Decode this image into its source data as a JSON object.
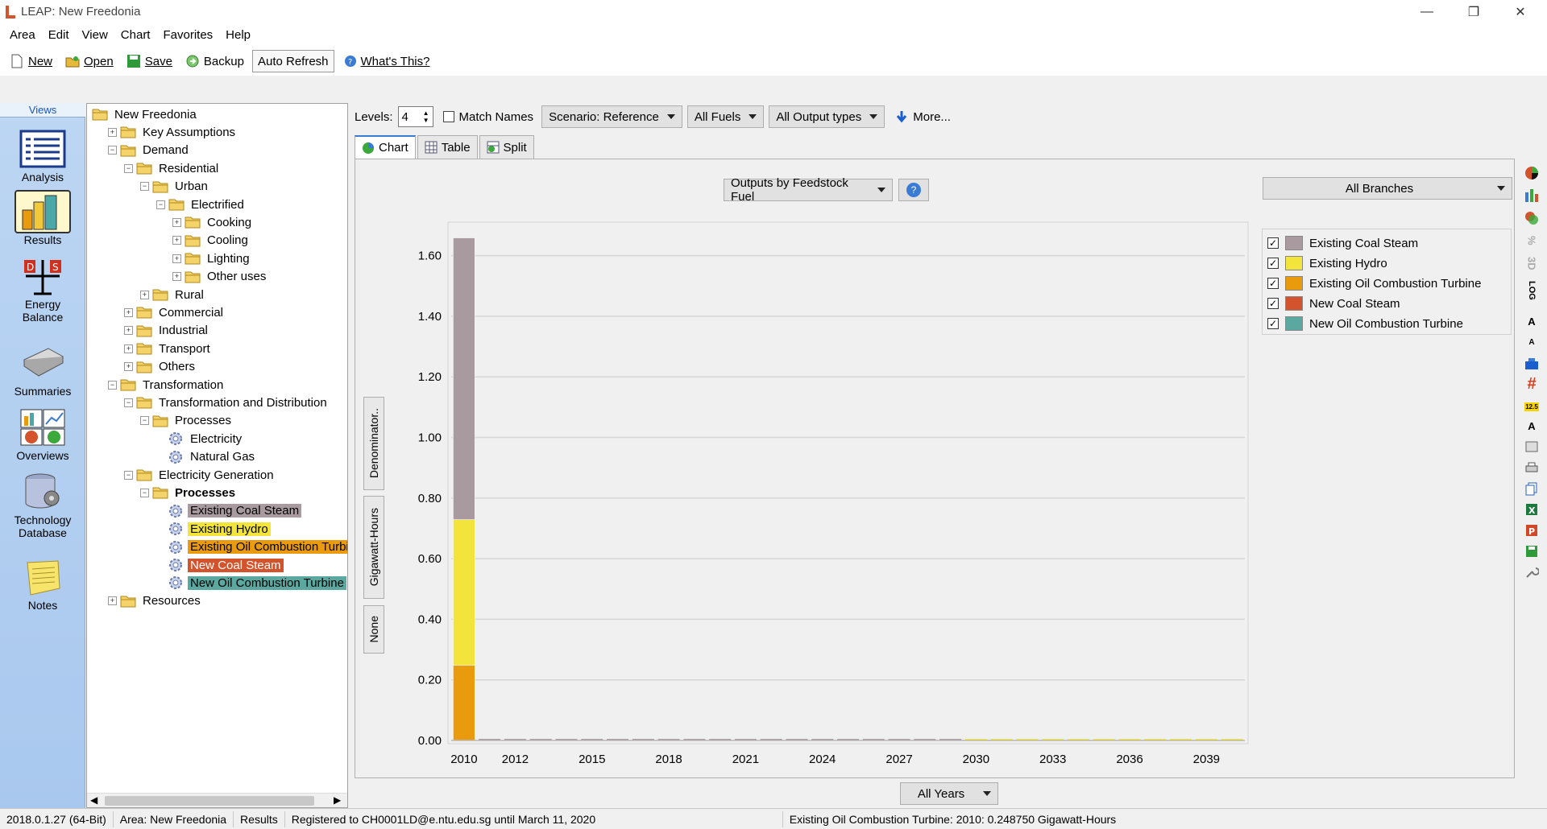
{
  "window": {
    "title": "LEAP: New Freedonia",
    "min": "—",
    "restore": "❐",
    "close": "✕"
  },
  "menu": [
    "Area",
    "Edit",
    "View",
    "Chart",
    "Favorites",
    "Help"
  ],
  "toolbar": {
    "new": "New",
    "open": "Open",
    "save": "Save",
    "backup": "Backup",
    "auto_refresh": "Auto Refresh",
    "whats_this": "What's This?"
  },
  "views": {
    "header": "Views",
    "items": [
      {
        "label": "Analysis",
        "icon": "analysis-icon"
      },
      {
        "label": "Results",
        "icon": "results-icon"
      },
      {
        "label": "Energy\nBalance",
        "icon": "energy-balance-icon"
      },
      {
        "label": "Summaries",
        "icon": "summaries-icon"
      },
      {
        "label": "Overviews",
        "icon": "overviews-icon"
      },
      {
        "label": "Technology\nDatabase",
        "icon": "technology-database-icon"
      },
      {
        "label": "Notes",
        "icon": "notes-icon"
      }
    ]
  },
  "tree": [
    {
      "label": "New Freedonia",
      "level": 0,
      "pm": "",
      "kind": "folder"
    },
    {
      "label": "Key Assumptions",
      "level": 1,
      "pm": "+",
      "kind": "folder"
    },
    {
      "label": "Demand",
      "level": 1,
      "pm": "-",
      "kind": "folder"
    },
    {
      "label": "Residential",
      "level": 2,
      "pm": "-",
      "kind": "folder"
    },
    {
      "label": "Urban",
      "level": 3,
      "pm": "-",
      "kind": "folder"
    },
    {
      "label": "Electrified",
      "level": 4,
      "pm": "-",
      "kind": "folder"
    },
    {
      "label": "Cooking",
      "level": 5,
      "pm": "+",
      "kind": "folder"
    },
    {
      "label": "Cooling",
      "level": 5,
      "pm": "+",
      "kind": "folder"
    },
    {
      "label": "Lighting",
      "level": 5,
      "pm": "+",
      "kind": "folder"
    },
    {
      "label": "Other uses",
      "level": 5,
      "pm": "+",
      "kind": "folder"
    },
    {
      "label": "Rural",
      "level": 3,
      "pm": "+",
      "kind": "folder"
    },
    {
      "label": "Commercial",
      "level": 2,
      "pm": "+",
      "kind": "folder"
    },
    {
      "label": "Industrial",
      "level": 2,
      "pm": "+",
      "kind": "folder"
    },
    {
      "label": "Transport",
      "level": 2,
      "pm": "+",
      "kind": "folder"
    },
    {
      "label": "Others",
      "level": 2,
      "pm": "+",
      "kind": "folder"
    },
    {
      "label": "Transformation",
      "level": 1,
      "pm": "-",
      "kind": "folder"
    },
    {
      "label": "Transformation and Distribution",
      "level": 2,
      "pm": "-",
      "kind": "folder"
    },
    {
      "label": "Processes",
      "level": 3,
      "pm": "-",
      "kind": "folder"
    },
    {
      "label": "Electricity",
      "level": 4,
      "pm": "",
      "kind": "gear"
    },
    {
      "label": "Natural Gas",
      "level": 4,
      "pm": "",
      "kind": "gear"
    },
    {
      "label": "Electricity Generation",
      "level": 2,
      "pm": "-",
      "kind": "folder"
    },
    {
      "label": "Processes",
      "level": 3,
      "pm": "-",
      "kind": "folder",
      "bold": true
    },
    {
      "label": "Existing Coal Steam",
      "level": 4,
      "pm": "",
      "kind": "gear",
      "hl": "#a99aa0",
      "fg": "#000"
    },
    {
      "label": "Existing Hydro",
      "level": 4,
      "pm": "",
      "kind": "gear",
      "hl": "#f2e43a",
      "fg": "#000"
    },
    {
      "label": "Existing Oil Combustion Turbi",
      "level": 4,
      "pm": "",
      "kind": "gear",
      "hl": "#ea9a0d",
      "fg": "#000"
    },
    {
      "label": "New Coal Steam",
      "level": 4,
      "pm": "",
      "kind": "gear",
      "hl": "#d2532c",
      "fg": "#fff"
    },
    {
      "label": "New Oil Combustion Turbine",
      "level": 4,
      "pm": "",
      "kind": "gear",
      "hl": "#5ba8a0",
      "fg": "#000"
    },
    {
      "label": "Resources",
      "level": 1,
      "pm": "+",
      "kind": "folder"
    }
  ],
  "controls": {
    "levels_label": "Levels:",
    "levels_value": "4",
    "match_names": "Match Names",
    "scenario": "Scenario: Reference",
    "fuels": "All Fuels",
    "output_types": "All Output types",
    "more": "More..."
  },
  "tabs": [
    "Chart",
    "Table",
    "Split"
  ],
  "chart_controls": {
    "outputs": "Outputs by Feedstock Fuel",
    "help": "?",
    "branches": "All Branches",
    "years": "All Years"
  },
  "side_buttons": [
    "Denominator..",
    "Gigawatt-Hours",
    "None"
  ],
  "right_tools": [
    "LOG",
    "3D",
    "A",
    "12.5"
  ],
  "chart_data": {
    "type": "bar",
    "stacked": true,
    "x": [
      2010,
      2011,
      2012,
      2013,
      2014,
      2015,
      2016,
      2017,
      2018,
      2019,
      2020,
      2021,
      2022,
      2023,
      2024,
      2025,
      2026,
      2027,
      2028,
      2029,
      2030,
      2031,
      2032,
      2033,
      2034,
      2035,
      2036,
      2037,
      2038,
      2039,
      2040
    ],
    "x_tick_labels": [
      "2010",
      "2012",
      "2015",
      "2018",
      "2021",
      "2024",
      "2027",
      "2030",
      "2033",
      "2036",
      "2039"
    ],
    "y_tick_labels": [
      "0.00",
      "0.20",
      "0.40",
      "0.60",
      "0.80",
      "1.00",
      "1.20",
      "1.40",
      "1.60"
    ],
    "ylim": [
      0,
      1.7
    ],
    "ylabel": "Gigawatt-Hours",
    "grid": true,
    "legend_position": "right",
    "series": [
      {
        "name": "Existing Oil Combustion Turbine",
        "color": "#ea9a0d",
        "values": [
          0.24875,
          0,
          0,
          0,
          0,
          0,
          0,
          0,
          0,
          0,
          0,
          0,
          0,
          0,
          0,
          0,
          0,
          0,
          0,
          0,
          0,
          0,
          0,
          0,
          0,
          0,
          0,
          0,
          0,
          0,
          0
        ]
      },
      {
        "name": "Existing Hydro",
        "color": "#f2e43a",
        "values": [
          0.48,
          0,
          0,
          0,
          0,
          0,
          0,
          0,
          0,
          0,
          0,
          0,
          0,
          0,
          0,
          0,
          0,
          0,
          0,
          0,
          0.005,
          0.005,
          0.005,
          0.005,
          0.005,
          0.005,
          0.005,
          0.005,
          0.005,
          0.005,
          0.005
        ]
      },
      {
        "name": "Existing Coal Steam",
        "color": "#a99aa0",
        "values": [
          0.93,
          0.005,
          0.005,
          0.005,
          0.005,
          0.005,
          0.005,
          0.005,
          0.005,
          0.005,
          0.005,
          0.005,
          0.005,
          0.005,
          0.005,
          0.005,
          0.005,
          0.005,
          0.005,
          0.005,
          0,
          0,
          0,
          0,
          0,
          0,
          0,
          0,
          0,
          0,
          0
        ]
      },
      {
        "name": "New Coal Steam",
        "color": "#d2532c",
        "values": [
          0,
          0,
          0,
          0,
          0,
          0,
          0,
          0,
          0,
          0,
          0,
          0,
          0,
          0,
          0,
          0,
          0,
          0,
          0,
          0,
          0,
          0,
          0,
          0,
          0,
          0,
          0,
          0,
          0,
          0,
          0
        ]
      },
      {
        "name": "New Oil Combustion Turbine",
        "color": "#5ba8a0",
        "values": [
          0,
          0,
          0,
          0,
          0,
          0,
          0,
          0,
          0,
          0,
          0,
          0,
          0,
          0,
          0,
          0,
          0,
          0,
          0,
          0,
          0,
          0,
          0,
          0,
          0,
          0,
          0,
          0,
          0,
          0,
          0
        ]
      }
    ]
  },
  "legend": [
    {
      "label": "Existing Coal Steam",
      "color": "#a99aa0",
      "checked": "✓"
    },
    {
      "label": "Existing  Hydro",
      "color": "#f2e43a",
      "checked": "✓"
    },
    {
      "label": "Existing Oil Combustion Turbine",
      "color": "#ea9a0d",
      "checked": "✓"
    },
    {
      "label": "New Coal Steam",
      "color": "#d2532c",
      "checked": "✓"
    },
    {
      "label": "New Oil Combustion Turbine",
      "color": "#5ba8a0",
      "checked": "✓"
    }
  ],
  "status": {
    "version": "2018.0.1.27 (64-Bit)",
    "area": "Area: New Freedonia",
    "view": "Results",
    "registered": "Registered to CH0001LD@e.ntu.edu.sg until March 11, 2020",
    "hover": "Existing Oil Combustion Turbine: 2010: 0.248750 Gigawatt-Hours"
  }
}
